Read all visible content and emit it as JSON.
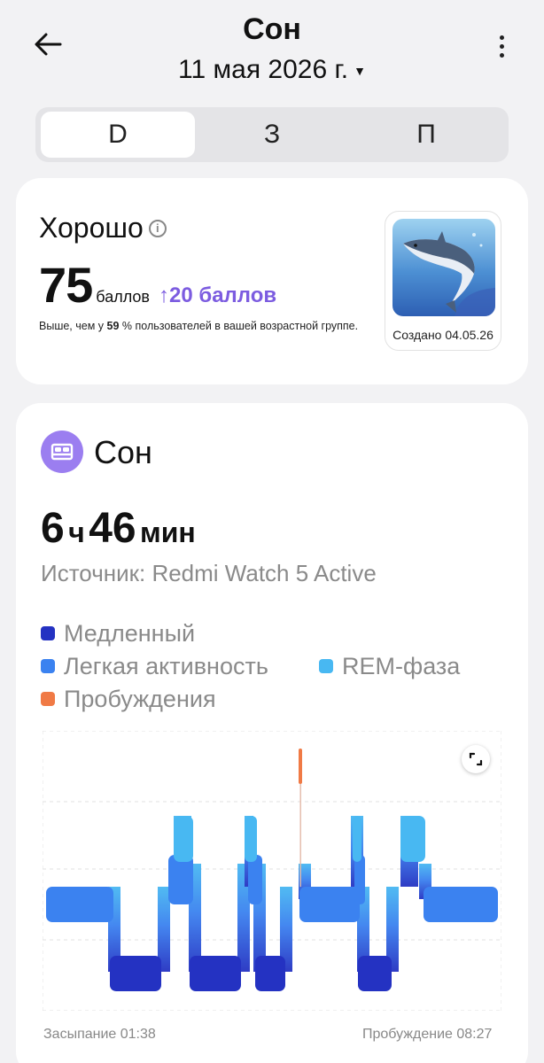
{
  "header": {
    "title": "Сон",
    "date": "11 мая 2026 г.",
    "back_icon": "arrow-left-icon",
    "more_icon": "more-vertical-icon"
  },
  "tabs": [
    {
      "label": "D",
      "active": true
    },
    {
      "label": "З",
      "active": false
    },
    {
      "label": "П",
      "active": false
    }
  ],
  "score_card": {
    "rating": "Хорошо",
    "score": "75",
    "score_unit": "баллов",
    "delta": "20 баллов",
    "delta_arrow": "↑",
    "compare_prefix": "Выше, чем у",
    "compare_value": "59",
    "compare_suffix": "% пользователей в вашей возрастной группе.",
    "badge_caption": "Создано 04.05.26",
    "accent": "#7c5ce0"
  },
  "sleep_card": {
    "title": "Сон",
    "hours": "6",
    "hours_unit": "ч",
    "minutes": "46",
    "minutes_unit": "мин",
    "source": "Источник: Redmi Watch 5 Active",
    "legend": [
      {
        "label": "Медленный",
        "color": "#2432c2"
      },
      {
        "label": "Легкая активность",
        "color": "#3b82f0"
      },
      {
        "label": "REM-фаза",
        "color": "#48b8f2"
      },
      {
        "label": "Пробуждения",
        "color": "#f07a45"
      }
    ],
    "sleep_start": "Засыпание 01:38",
    "wake_up": "Пробуждение 08:27"
  }
}
